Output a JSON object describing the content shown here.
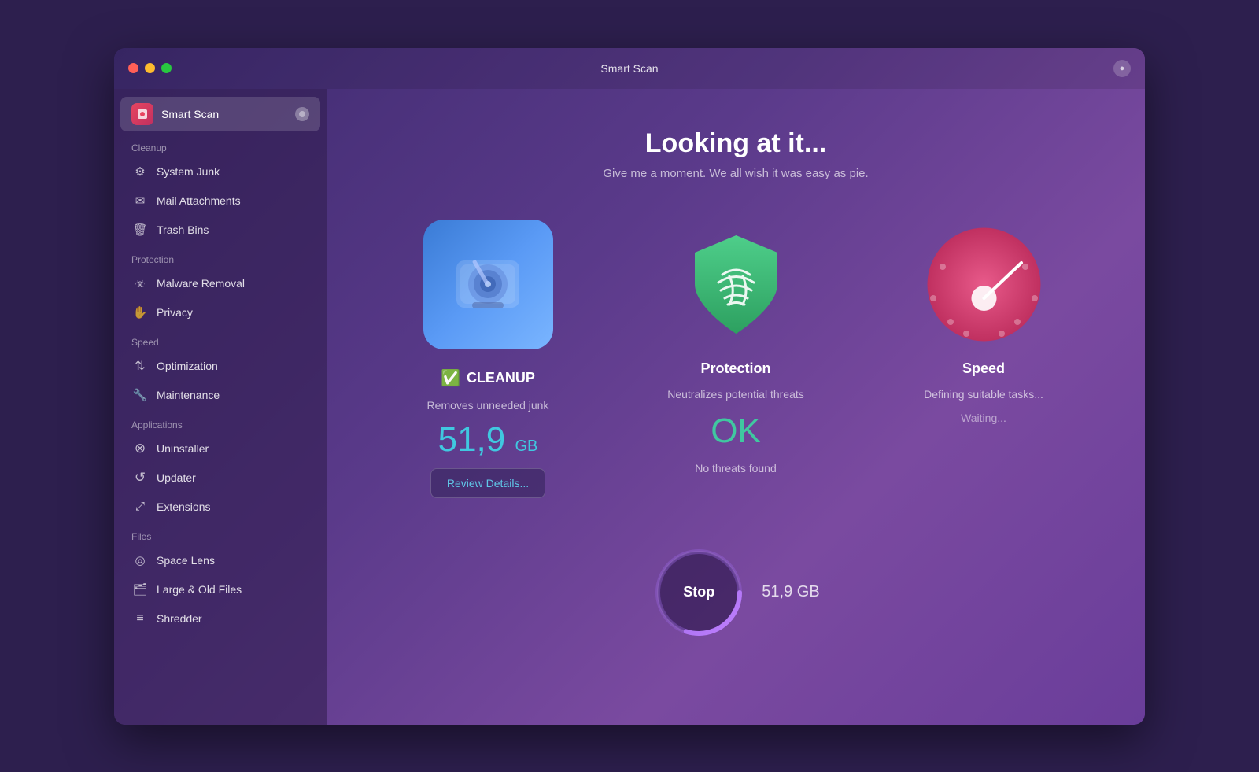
{
  "window": {
    "title": "Smart Scan"
  },
  "sidebar": {
    "active_item": {
      "label": "Smart Scan",
      "icon": "🖥"
    },
    "sections": [
      {
        "label": "Cleanup",
        "items": [
          {
            "label": "System Junk",
            "icon": "⚙"
          },
          {
            "label": "Mail Attachments",
            "icon": "✉"
          },
          {
            "label": "Trash Bins",
            "icon": "🗑"
          }
        ]
      },
      {
        "label": "Protection",
        "items": [
          {
            "label": "Malware Removal",
            "icon": "☣"
          },
          {
            "label": "Privacy",
            "icon": "✋"
          }
        ]
      },
      {
        "label": "Speed",
        "items": [
          {
            "label": "Optimization",
            "icon": "⇅"
          },
          {
            "label": "Maintenance",
            "icon": "🔧"
          }
        ]
      },
      {
        "label": "Applications",
        "items": [
          {
            "label": "Uninstaller",
            "icon": "⊗"
          },
          {
            "label": "Updater",
            "icon": "↺"
          },
          {
            "label": "Extensions",
            "icon": "⤢"
          }
        ]
      },
      {
        "label": "Files",
        "items": [
          {
            "label": "Space Lens",
            "icon": "◎"
          },
          {
            "label": "Large & Old Files",
            "icon": "🗂"
          },
          {
            "label": "Shredder",
            "icon": "≡"
          }
        ]
      }
    ]
  },
  "content": {
    "title": "Looking at it...",
    "subtitle": "Give me a moment. We all wish it was easy as pie.",
    "cards": [
      {
        "name": "CLEANUP",
        "has_check": true,
        "desc": "Removes unneeded junk",
        "value": "51,9",
        "unit": "GB",
        "action_label": "Review Details..."
      },
      {
        "name": "Protection",
        "has_check": false,
        "desc": "Neutralizes potential threats",
        "value": "OK",
        "status": "No threats found"
      },
      {
        "name": "Speed",
        "has_check": false,
        "desc": "Defining suitable tasks...",
        "waiting": "Waiting..."
      }
    ],
    "stop_label": "Stop",
    "stop_value": "51,9 GB"
  }
}
